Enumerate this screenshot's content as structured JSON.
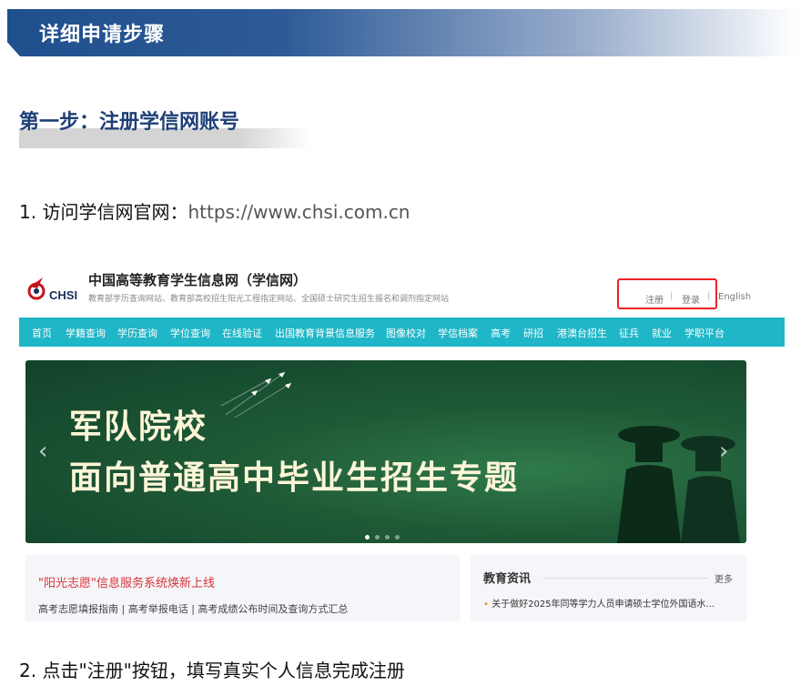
{
  "section": {
    "title": "详细申请步骤"
  },
  "step1": {
    "title": "第一步：注册学信网账号"
  },
  "instructions": {
    "item1_prefix": "1. 访问学信网官网：",
    "item1_url": "https://www.chsi.com.cn",
    "item2": "2. 点击\"注册\"按钮，填写真实个人信息完成注册"
  },
  "site": {
    "logo_text": "CHSI",
    "name": "中国高等教育学生信息网（学信网）",
    "desc": "教育部学历查询网站、教育部高校招生阳光工程指定网站、全国硕士研究生招生报名和调剂指定网站",
    "top_links": [
      "注册",
      "登录",
      "English"
    ],
    "nav": [
      "首页",
      "学籍查询",
      "学历查询",
      "学位查询",
      "在线验证",
      "出国教育背景信息服务",
      "图像校对",
      "学信档案",
      "高考",
      "研招",
      "港澳台招生",
      "征兵",
      "就业",
      "学职平台"
    ],
    "carousel": {
      "line1": "军队院校",
      "line2": "面向普通高中毕业生招生专题"
    },
    "news": {
      "headline": "\"阳光志愿\"信息服务系统焕新上线",
      "links": "高考志愿填报指南  |  高考举报电话  |  高考成绩公布时间及查询方式汇总"
    },
    "edu": {
      "title": "教育资讯",
      "more": "更多",
      "item": "关于做好2025年同等学力人员申请硕士学位外国语水..."
    }
  }
}
